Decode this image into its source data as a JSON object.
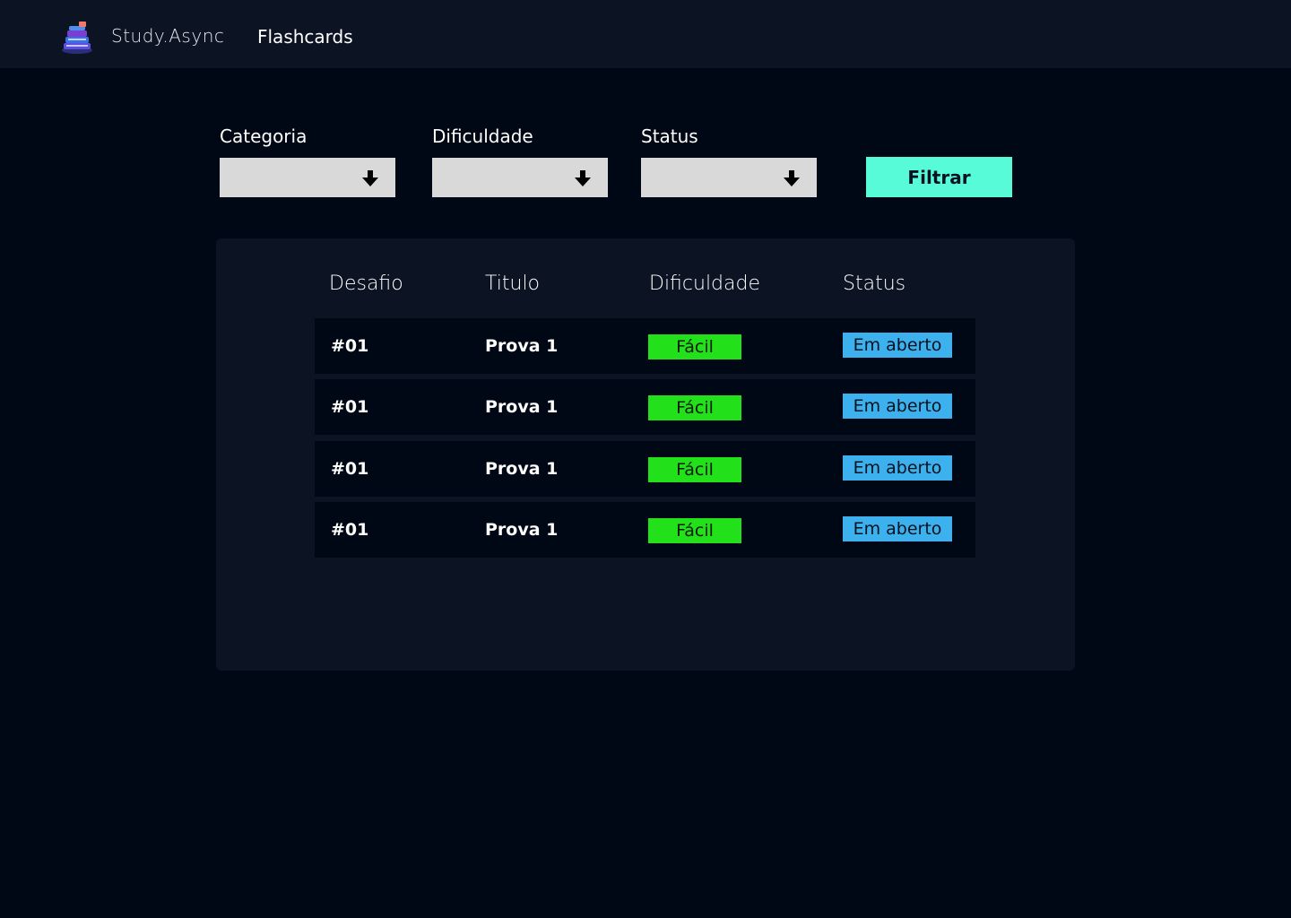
{
  "header": {
    "brand": "Study.Async",
    "nav_link": "Flashcards"
  },
  "filters": {
    "category_label": "Categoria",
    "difficulty_label": "Dificuldade",
    "status_label": "Status",
    "filter_button": "Filtrar"
  },
  "table": {
    "columns": [
      "Desafio",
      "Titulo",
      "Dificuldade",
      "Status"
    ],
    "rows": [
      {
        "desafio": "#01",
        "titulo": "Prova 1",
        "dificuldade": "Fácil",
        "status": "Em aberto"
      },
      {
        "desafio": "#01",
        "titulo": "Prova 1",
        "dificuldade": "Fácil",
        "status": "Em aberto"
      },
      {
        "desafio": "#01",
        "titulo": "Prova 1",
        "dificuldade": "Fácil",
        "status": "Em aberto"
      },
      {
        "desafio": "#01",
        "titulo": "Prova 1",
        "dificuldade": "Fácil",
        "status": "Em aberto"
      }
    ]
  },
  "colors": {
    "accent": "#57fbd8",
    "easy": "#22e11a",
    "open": "#3db1ee"
  }
}
